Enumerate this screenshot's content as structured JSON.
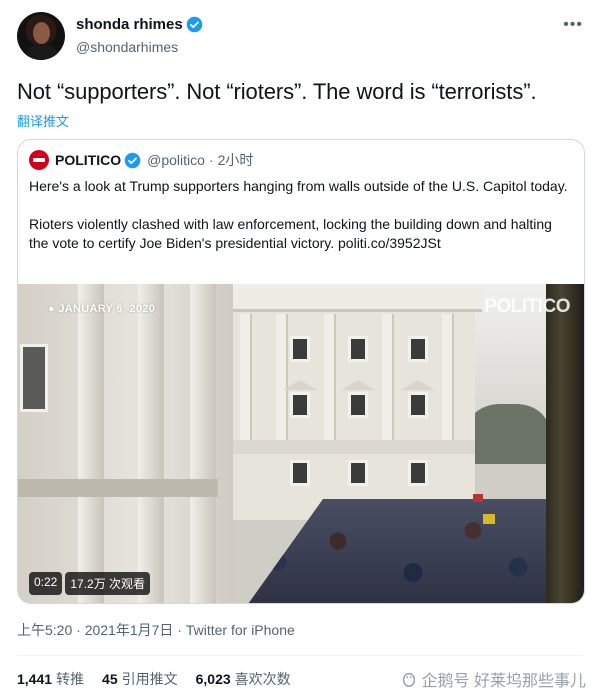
{
  "author": {
    "display_name": "shonda rhimes",
    "handle": "@shondarhimes",
    "verified": true,
    "avatar_icon": "avatar-photo",
    "more_icon": "more-dots-icon"
  },
  "tweet": {
    "text": "Not “supporters”. Not “rioters”.  The word is “terrorists”.",
    "translate_label": "翻译推文"
  },
  "quoted": {
    "display_name": "POLITICO",
    "handle": "@politico",
    "separator": "·",
    "time": "2小时",
    "paragraphs": [
      "Here's a look at Trump supporters hanging from walls outside of the U.S. Capitol today.",
      "Rioters violently clashed with law enforcement, locking the building down and halting the vote to certify Joe Biden's presidential victory. politi.co/3952JSt"
    ],
    "video": {
      "date_stamp": "JANUARY 6, 2020",
      "brand_stamp": "POLITICO",
      "duration": "0:22",
      "views": "17.2万 次观看"
    }
  },
  "meta": {
    "text": "上午5:20 · 2021年1月7日 · Twitter for iPhone"
  },
  "stats": [
    {
      "count": "1,441",
      "label": "转推"
    },
    {
      "count": "45",
      "label": "引用推文"
    },
    {
      "count": "6,023",
      "label": "喜欢次数"
    }
  ],
  "watermark": {
    "text": "企鹅号 好莱坞那些事儿"
  },
  "colors": {
    "accent": "#1d9bf0",
    "text_primary": "#0f1419",
    "text_secondary": "#536471",
    "politico_red": "#d0021b"
  }
}
